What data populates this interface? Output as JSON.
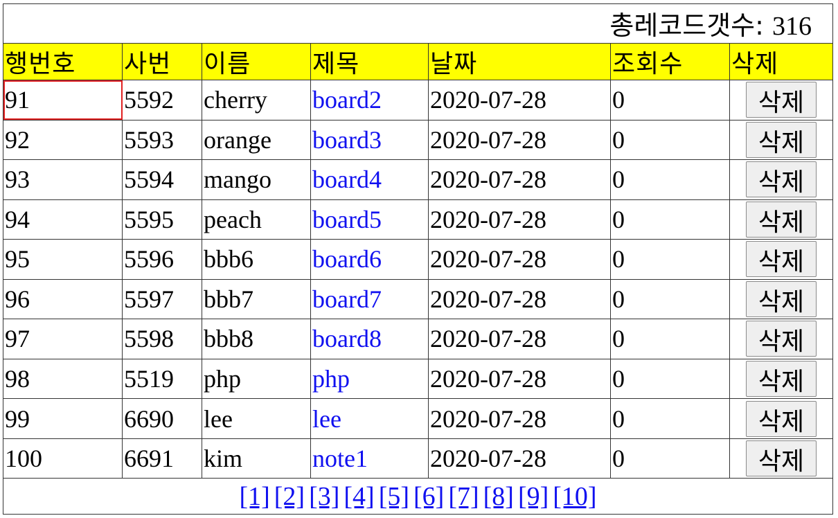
{
  "summary": {
    "record_count_label": "총레코드갯수: ",
    "record_count": "316"
  },
  "headers": {
    "row_no": "행번호",
    "emp_no": "사번",
    "name": "이름",
    "title": "제목",
    "date": "날짜",
    "views": "조회수",
    "delete": "삭제"
  },
  "rows": [
    {
      "row_no": "91",
      "emp_no": "5592",
      "name": "cherry",
      "title": "board2",
      "date": "2020-07-28",
      "views": "0",
      "delete_label": "삭제"
    },
    {
      "row_no": "92",
      "emp_no": "5593",
      "name": "orange",
      "title": "board3",
      "date": "2020-07-28",
      "views": "0",
      "delete_label": "삭제"
    },
    {
      "row_no": "93",
      "emp_no": "5594",
      "name": "mango",
      "title": "board4",
      "date": "2020-07-28",
      "views": "0",
      "delete_label": "삭제"
    },
    {
      "row_no": "94",
      "emp_no": "5595",
      "name": "peach",
      "title": "board5",
      "date": "2020-07-28",
      "views": "0",
      "delete_label": "삭제"
    },
    {
      "row_no": "95",
      "emp_no": "5596",
      "name": "bbb6",
      "title": "board6",
      "date": "2020-07-28",
      "views": "0",
      "delete_label": "삭제"
    },
    {
      "row_no": "96",
      "emp_no": "5597",
      "name": "bbb7",
      "title": "board7",
      "date": "2020-07-28",
      "views": "0",
      "delete_label": "삭제"
    },
    {
      "row_no": "97",
      "emp_no": "5598",
      "name": "bbb8",
      "title": "board8",
      "date": "2020-07-28",
      "views": "0",
      "delete_label": "삭제"
    },
    {
      "row_no": "98",
      "emp_no": "5519",
      "name": "php",
      "title": "php",
      "date": "2020-07-28",
      "views": "0",
      "delete_label": "삭제"
    },
    {
      "row_no": "99",
      "emp_no": "6690",
      "name": "lee",
      "title": "lee",
      "date": "2020-07-28",
      "views": "0",
      "delete_label": "삭제"
    },
    {
      "row_no": "100",
      "emp_no": "6691",
      "name": "kim",
      "title": "note1",
      "date": "2020-07-28",
      "views": "0",
      "delete_label": "삭제"
    }
  ],
  "pager": {
    "pages": [
      "[1]",
      "[2]",
      "[3]",
      "[4]",
      "[5]",
      "[6]",
      "[7]",
      "[8]",
      "[9]",
      "[10]"
    ]
  },
  "colors": {
    "header_bg": "#ffff00",
    "link": "#1010f0",
    "selection_outline": "#e02020"
  }
}
